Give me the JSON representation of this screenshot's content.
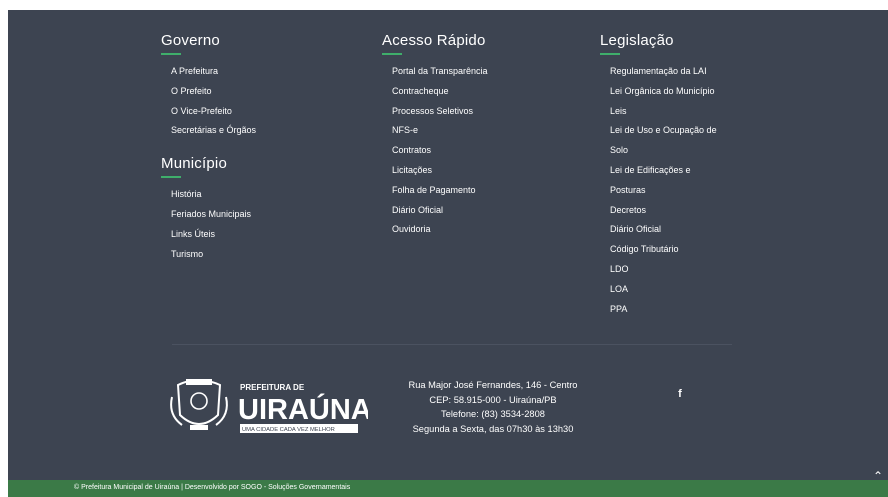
{
  "columns": [
    {
      "sections": [
        {
          "title": "Governo",
          "items": [
            "A Prefeitura",
            "O Prefeito",
            "O Vice-Prefeito",
            "Secretárias e Órgãos"
          ]
        },
        {
          "title": "Município",
          "items": [
            "História",
            "Feriados Municipais",
            "Links Úteis",
            "Turismo"
          ]
        }
      ]
    },
    {
      "sections": [
        {
          "title": "Acesso Rápido",
          "items": [
            "Portal da Transparência",
            "Contracheque",
            "Processos Seletivos",
            "NFS-e",
            "Contratos",
            "Licitações",
            "Folha de Pagamento",
            "Diário Oficial",
            "Ouvidoria"
          ]
        }
      ]
    },
    {
      "sections": [
        {
          "title": "Legislação",
          "items": [
            "Regulamentação da LAI",
            "Lei Orgânica do Município",
            "Leis",
            "Lei de Uso e Ocupação de",
            "Solo",
            "Lei de Edificações e",
            "Posturas",
            "Decretos",
            "Diário Oficial",
            "Código Tributário",
            "LDO",
            "LOA",
            "PPA"
          ]
        }
      ]
    }
  ],
  "logo": {
    "line1": "PREFEITURA DE",
    "line2": "UIRAÚNA",
    "tagline": "UMA CIDADE CADA VEZ MELHOR"
  },
  "address": [
    "Rua Major José Fernandes, 146 - Centro",
    "CEP: 58.915-000 - Uiraúna/PB",
    "Telefone: (83) 3534-2808",
    "Segunda a Sexta, das 07h30 às 13h30"
  ],
  "social": {
    "facebook_glyph": "f"
  },
  "copyright": "© Prefeitura Municipal de Uiraúna | Desenvolvido por SOGO - Soluções Governamentais",
  "to_top_glyph": "⌃"
}
